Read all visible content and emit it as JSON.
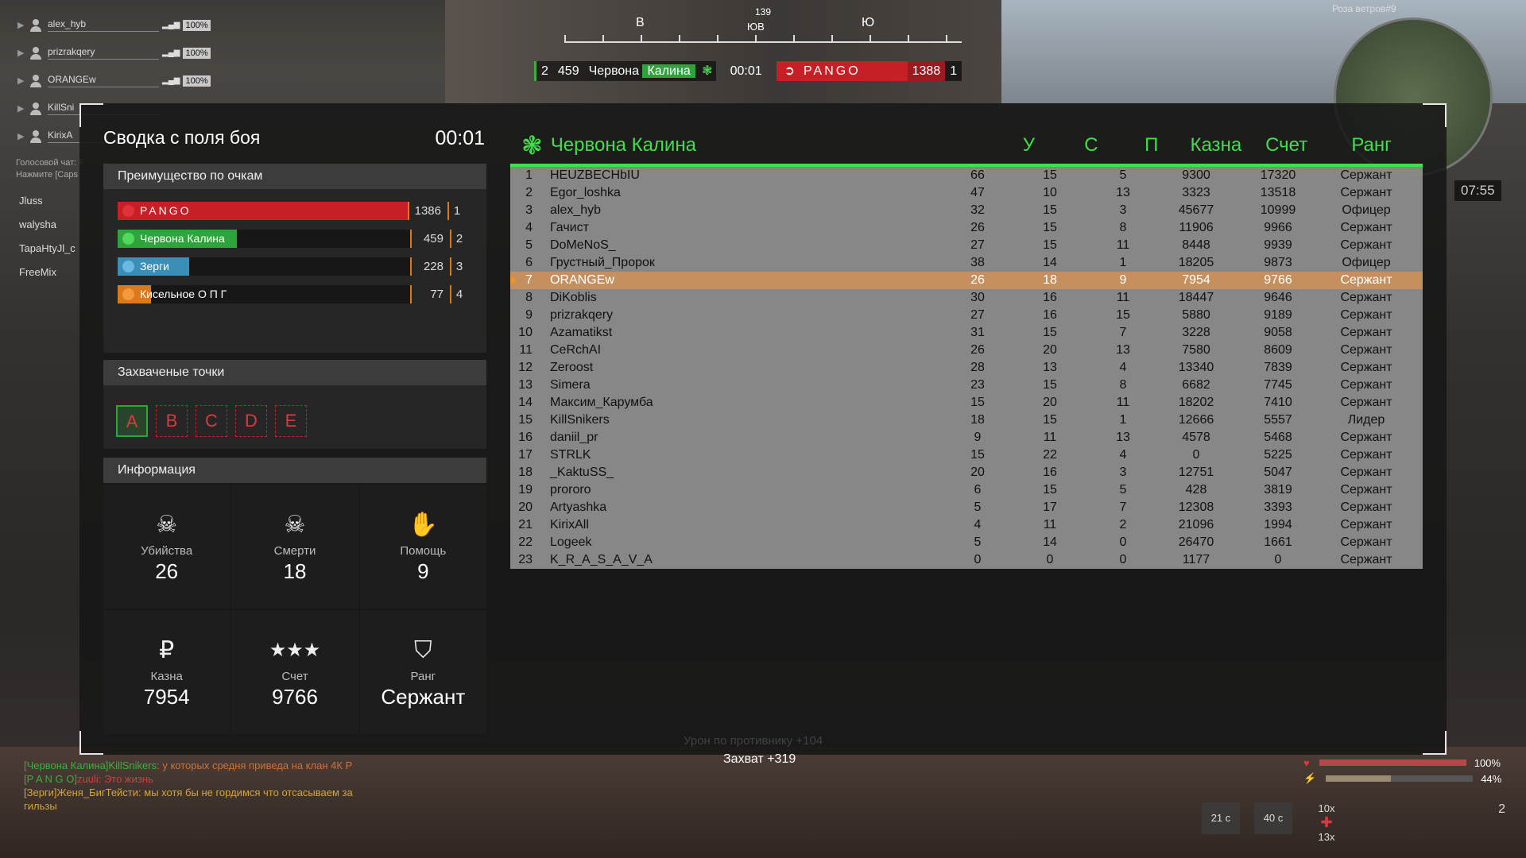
{
  "squad": [
    {
      "name": "alex_hyb",
      "hp": "100%"
    },
    {
      "name": "prizrakqery",
      "hp": "100%"
    },
    {
      "name": "ORANGEw",
      "hp": "100%"
    },
    {
      "name": "KillSni",
      "hp": ""
    },
    {
      "name": "KirixA",
      "hp": ""
    }
  ],
  "voice": {
    "line1": "Голосовой чат: F",
    "line2": "Нажмите [Caps"
  },
  "side_players": [
    "Jluss",
    "walysha",
    "TapaHtyJl_c",
    "FreeMix"
  ],
  "compass": {
    "left": "В",
    "mid": "ЮВ",
    "right": "Ю",
    "degrees": "139"
  },
  "topbar": {
    "team_rank": "2",
    "team_score": "459",
    "team_name_a": "Червона",
    "team_name_b": "Калина",
    "timer": "00:01",
    "enemy_name": "PANGO",
    "enemy_score": "1388",
    "enemy_rank": "1"
  },
  "minimap": {
    "title": "Роза ветров#9",
    "time": "07:55"
  },
  "summary": {
    "title": "Сводка с поля боя",
    "time": "00:01"
  },
  "advantage": {
    "title": "Преимущество по очкам",
    "teams": [
      {
        "name": "PANGO",
        "score": "1386",
        "place": "1",
        "color": "#c71f26",
        "icon_color": "#e0323a"
      },
      {
        "name": "Червона Калина",
        "score": "459",
        "place": "2",
        "color": "#2fa43a",
        "icon_color": "#52d85c"
      },
      {
        "name": "Зерги",
        "score": "228",
        "place": "3",
        "color": "#3b8fb7",
        "icon_color": "#69b9e2"
      },
      {
        "name": "Кисельное О П Г",
        "score": "77",
        "place": "4",
        "color": "#d97a1e",
        "icon_color": "#f39a3c"
      }
    ]
  },
  "captured": {
    "title": "Захваченые точки",
    "points": [
      "A",
      "B",
      "C",
      "D",
      "E"
    ],
    "owned": "A"
  },
  "info": {
    "title": "Информация",
    "stats": [
      {
        "icon": "skull-icon",
        "symbol": "☠",
        "label": "Убийства",
        "value": "26"
      },
      {
        "icon": "skull-crossbones-icon",
        "symbol": "☠",
        "label": "Смерти",
        "value": "18"
      },
      {
        "icon": "handshake-icon",
        "symbol": "✋",
        "label": "Помощь",
        "value": "9"
      },
      {
        "icon": "ruble-icon",
        "symbol": "₽",
        "label": "Казна",
        "value": "7954"
      },
      {
        "icon": "stars-icon",
        "symbol": "★★★",
        "label": "Счет",
        "value": "9766"
      },
      {
        "icon": "rank-badge-icon",
        "symbol": "⛉",
        "label": "Ранг",
        "value": "Сержант"
      }
    ]
  },
  "scoreboard": {
    "team_name": "Червона Калина",
    "headers": {
      "kills": "У",
      "deaths": "С",
      "assists": "П",
      "treasury": "Казна",
      "score": "Счет",
      "rank": "Ранг"
    },
    "rows": [
      {
        "pos": "1",
        "name": "HEUZBECHbIU",
        "k": "66",
        "d": "15",
        "a": "5",
        "t": "9300",
        "s": "17320",
        "r": "Сержант"
      },
      {
        "pos": "2",
        "name": "Egor_loshka",
        "k": "47",
        "d": "10",
        "a": "13",
        "t": "3323",
        "s": "13518",
        "r": "Сержант"
      },
      {
        "pos": "3",
        "name": "alex_hyb",
        "k": "32",
        "d": "15",
        "a": "3",
        "t": "45677",
        "s": "10999",
        "r": "Офицер"
      },
      {
        "pos": "4",
        "name": "Гачист",
        "k": "26",
        "d": "15",
        "a": "8",
        "t": "11906",
        "s": "9966",
        "r": "Сержант"
      },
      {
        "pos": "5",
        "name": "DoMeNoS_",
        "k": "27",
        "d": "15",
        "a": "11",
        "t": "8448",
        "s": "9939",
        "r": "Сержант"
      },
      {
        "pos": "6",
        "name": "Грустный_Пророк",
        "k": "38",
        "d": "14",
        "a": "1",
        "t": "18205",
        "s": "9873",
        "r": "Офицер"
      },
      {
        "pos": "7",
        "name": "ORANGEw",
        "k": "26",
        "d": "18",
        "a": "9",
        "t": "7954",
        "s": "9766",
        "r": "Сержант",
        "me": true
      },
      {
        "pos": "8",
        "name": "DiKoblis",
        "k": "30",
        "d": "16",
        "a": "11",
        "t": "18447",
        "s": "9646",
        "r": "Сержант"
      },
      {
        "pos": "9",
        "name": "prizrakqery",
        "k": "27",
        "d": "16",
        "a": "15",
        "t": "5880",
        "s": "9189",
        "r": "Сержант"
      },
      {
        "pos": "10",
        "name": "Azamatikst",
        "k": "31",
        "d": "15",
        "a": "7",
        "t": "3228",
        "s": "9058",
        "r": "Сержант"
      },
      {
        "pos": "11",
        "name": "CeRchAI",
        "k": "26",
        "d": "20",
        "a": "13",
        "t": "7580",
        "s": "8609",
        "r": "Сержант"
      },
      {
        "pos": "12",
        "name": "Zeroost",
        "k": "28",
        "d": "13",
        "a": "4",
        "t": "13340",
        "s": "7839",
        "r": "Сержант"
      },
      {
        "pos": "13",
        "name": "Simera",
        "k": "23",
        "d": "15",
        "a": "8",
        "t": "6682",
        "s": "7745",
        "r": "Сержант"
      },
      {
        "pos": "14",
        "name": "Максим_Карумба",
        "k": "15",
        "d": "20",
        "a": "11",
        "t": "18202",
        "s": "7410",
        "r": "Сержант"
      },
      {
        "pos": "15",
        "name": "KillSnikers",
        "k": "18",
        "d": "15",
        "a": "1",
        "t": "12666",
        "s": "5557",
        "r": "Лидер"
      },
      {
        "pos": "16",
        "name": "daniil_pr",
        "k": "9",
        "d": "11",
        "a": "13",
        "t": "4578",
        "s": "5468",
        "r": "Сержант"
      },
      {
        "pos": "17",
        "name": "STRLK",
        "k": "15",
        "d": "22",
        "a": "4",
        "t": "0",
        "s": "5225",
        "r": "Сержант"
      },
      {
        "pos": "18",
        "name": "_KaktuSS_",
        "k": "20",
        "d": "16",
        "a": "3",
        "t": "12751",
        "s": "5047",
        "r": "Сержант"
      },
      {
        "pos": "19",
        "name": "prororo",
        "k": "6",
        "d": "15",
        "a": "5",
        "t": "428",
        "s": "3819",
        "r": "Сержант"
      },
      {
        "pos": "20",
        "name": "Artyashka",
        "k": "5",
        "d": "17",
        "a": "7",
        "t": "12308",
        "s": "3393",
        "r": "Сержант"
      },
      {
        "pos": "21",
        "name": "KirixAll",
        "k": "4",
        "d": "11",
        "a": "2",
        "t": "21096",
        "s": "1994",
        "r": "Сержант"
      },
      {
        "pos": "22",
        "name": "Logeek",
        "k": "5",
        "d": "14",
        "a": "0",
        "t": "26470",
        "s": "1661",
        "r": "Сержант"
      },
      {
        "pos": "23",
        "name": "K_R_A_S_A_V_A",
        "k": "0",
        "d": "0",
        "a": "0",
        "t": "1177",
        "s": "0",
        "r": "Сержант"
      }
    ]
  },
  "chat": [
    {
      "tag": "[Червона Калина]",
      "tag_color": "#3fae3f",
      "user": "KillSnikers",
      "user_color": "#3fae3f",
      "text": ": у которых средня приведа на клан 4К Р",
      "text_color": "#c9743a"
    },
    {
      "tag": "[P A N G O]",
      "tag_color": "#3fae3f",
      "user": "zuuli",
      "user_color": "#d83b3f",
      "text": ": Это жизнь",
      "text_color": "#d83b3f"
    },
    {
      "tag": "[Зерги]",
      "tag_color": "#d4a441",
      "user": "Женя_БигТейсти",
      "user_color": "#d4a441",
      "text": ": мы хотя бы не гордимся что отсасываем за гильзы",
      "text_color": "#d4a441"
    }
  ],
  "capture_notice": "Захват +319",
  "damage_notice": "Урон по противнику +104",
  "hud": {
    "health": "100%",
    "health_level": 1.0,
    "armor": "44%",
    "armor_level": 0.44,
    "skill1": "21 с",
    "skill2": "40 с",
    "ammo_mult": "10x",
    "ammo_count": "13x",
    "grenades": "2"
  },
  "colors": {
    "accent_green": "#3fe04a",
    "pango_red": "#c71f26",
    "highlight_row": "#cd915a"
  }
}
